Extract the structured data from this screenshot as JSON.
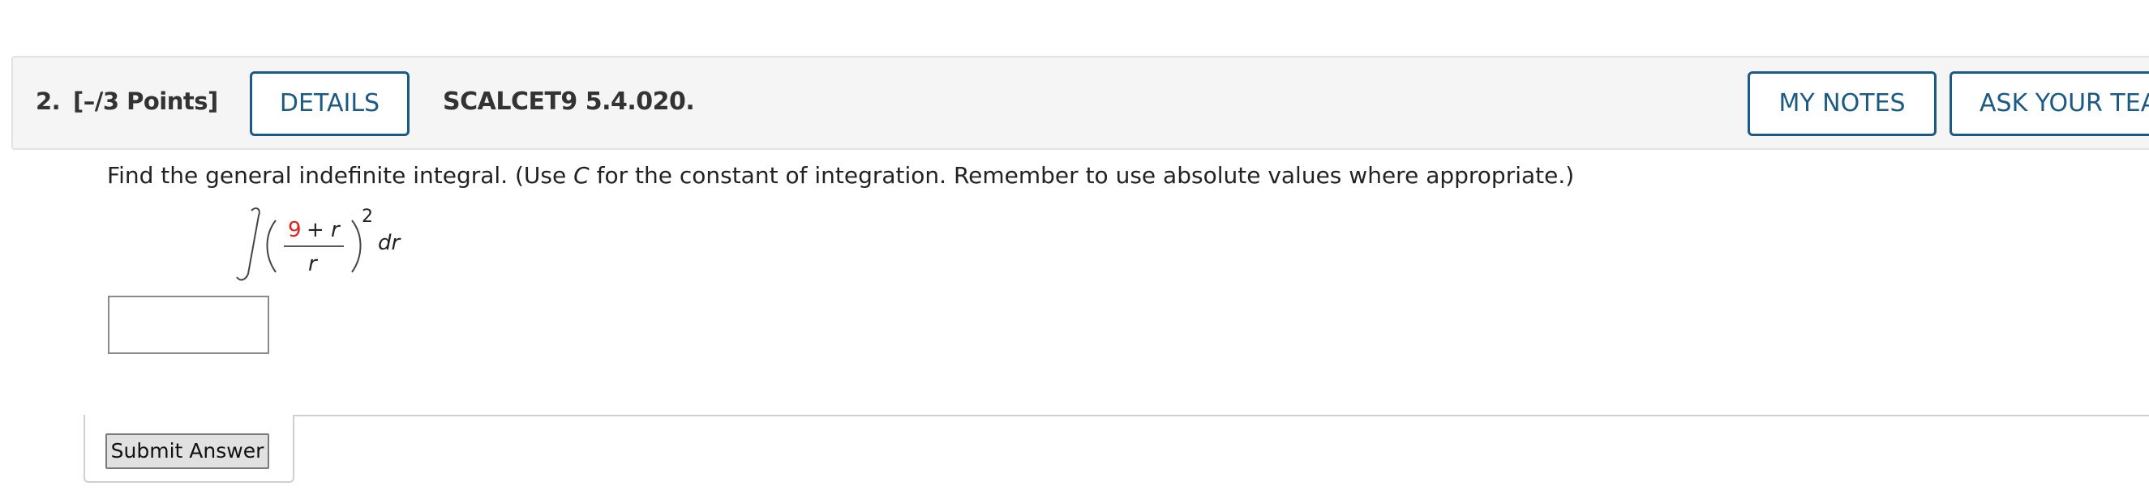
{
  "question": {
    "number": "2.",
    "points": "[–/3 Points]",
    "code": "SCALCET9 5.4.020."
  },
  "toolbar": {
    "details_label": "DETAILS",
    "my_notes_label": "MY NOTES",
    "ask_teacher_label": "ASK YOUR TEA"
  },
  "prompt": {
    "before_c": "Find the general indefinite integral. (Use ",
    "c_var": "C",
    "after_c": " for the constant of integration. Remember to use absolute values where appropriate.)"
  },
  "integral": {
    "numerator_constant": "9",
    "numerator_rest": "+ r",
    "denominator": "r",
    "exponent": "2",
    "differential": "dr",
    "highlight_color": "#e0201c"
  },
  "answer": {
    "value": ""
  },
  "submit": {
    "label": "Submit Answer"
  }
}
